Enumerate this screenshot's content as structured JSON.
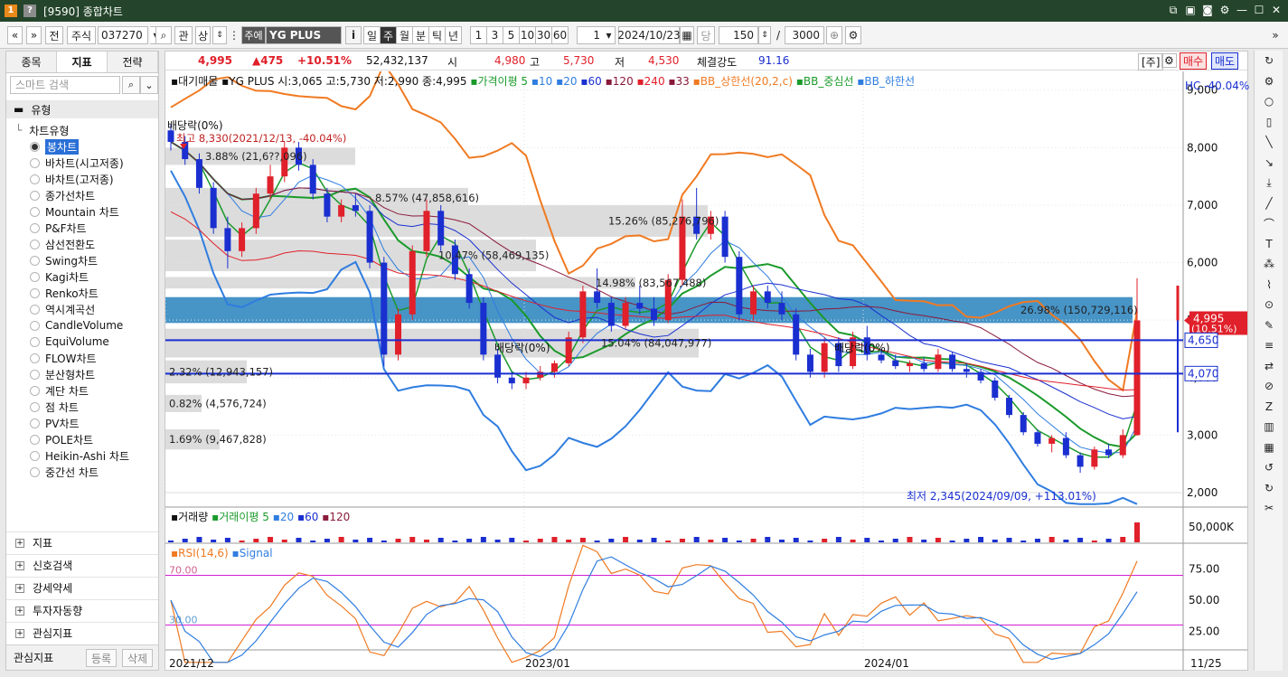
{
  "window": {
    "title": "[9590] 종합차트",
    "logo": "1",
    "help": "?"
  },
  "toolbar": {
    "nav_prev": "«",
    "nav_down": "»",
    "prev_label": "전",
    "market": "주식",
    "code": "037270",
    "search_icon": "search-icon",
    "kwan": "관",
    "sang": "상",
    "stock_badge": "주에",
    "stock_name": "YG PLUS",
    "info": "i",
    "periods": [
      "일",
      "주",
      "월",
      "분",
      "틱",
      "년"
    ],
    "active_period": "주",
    "intervals": [
      "1",
      "3",
      "5",
      "10",
      "30",
      "60"
    ],
    "spin_value": "1",
    "date": "2024/10/23",
    "dang": "당",
    "count": "150",
    "slash": "/",
    "total": "3000"
  },
  "left": {
    "tabs": [
      "종목",
      "지표",
      "전략"
    ],
    "active_tab": "지표",
    "search_placeholder": "스마트 검색",
    "group": "유형",
    "tree_title": "차트유형",
    "items": [
      "봉차트",
      "바차트(시고저종)",
      "바차트(고저종)",
      "종가선차트",
      "Mountain 차트",
      "P&F차트",
      "삼선전환도",
      "Swing차트",
      "Kagi차트",
      "Renko차트",
      "역시계곡선",
      "CandleVolume",
      "EquiVolume",
      "FLOW차트",
      "분산형차트",
      "계단 차트",
      "점 차트",
      "PV차트",
      "POLE차트",
      "Heikin-Ashi 차트",
      "중간선 차트"
    ],
    "selected_item": "봉차트",
    "folders": [
      "지표",
      "신호검색",
      "강세약세",
      "투자자동향",
      "관심지표"
    ],
    "bottom_label": "관심지표",
    "register": "등록",
    "delete": "삭제"
  },
  "quote": {
    "price": "4,995",
    "change": "▲475",
    "rate": "+10.51%",
    "volume": "52,432,137",
    "open_label": "시",
    "open": "4,980",
    "high_label": "고",
    "high": "5,730",
    "low_label": "저",
    "low": "4,530",
    "strength_label": "체결강도",
    "strength": "91.16",
    "unit": "[주]",
    "buy": "매수",
    "sell": "매도"
  },
  "legend": {
    "title": "대기매물",
    "name_label": "YG PLUS",
    "ohlc": "시:3,065 고:5,730 저:2,990 종:4,995",
    "ma_label": "가격이평 5",
    "ma_periods": [
      "10",
      "20",
      "60",
      "120",
      "240",
      "33"
    ],
    "bb_upper": "BB_상한선(20,2,c)",
    "bb_mid": "BB_중심선",
    "bb_lower": "BB_하한선",
    "hc": "HC -40.04%"
  },
  "annotations": {
    "div1": "배당락(0%)",
    "high_note": "최고 8,330(2021/12/13, -40.04%)",
    "div2": "배당락(0%)",
    "div3": "배당락(0%)",
    "low_note": "최저 2,345(2024/09/09, +113.01%)"
  },
  "profile": [
    {
      "label": "3.88% (21,6??,096)",
      "color": "#dcdcdc"
    },
    {
      "label": "8.57% (47,858,616)",
      "color": "#dcdcdc"
    },
    {
      "label": "15.26% (85,276,796)",
      "color": "#dcdcdc"
    },
    {
      "label": "10.47% (58,469,135)",
      "color": "#dcdcdc"
    },
    {
      "label": "14.98% (83,567,488)",
      "color": "#dcdcdc"
    },
    {
      "label": "26.98% (150,729,116)",
      "color": "#3d8ec4"
    },
    {
      "label": "15.04% (84,047,977)",
      "color": "#dcdcdc"
    },
    {
      "label": "2.32% (12,943,157)",
      "color": "#dcdcdc"
    },
    {
      "label": "0.82% (4,576,724)",
      "color": "#dcdcdc"
    },
    {
      "label": "1.69% (9,467,828)",
      "color": "#dcdcdc"
    }
  ],
  "price_axis": [
    "9,000",
    "8,000",
    "7,000",
    "6,000",
    "5,000",
    "4,000",
    "3,000",
    "2,000"
  ],
  "price_marks": {
    "current": "4,995",
    "current_rate": "(10.51%)",
    "line1": "4,650",
    "line2": "4,070"
  },
  "volume_panel": {
    "title": "거래량",
    "ma": "거래이평 5",
    "periods": [
      "20",
      "60",
      "120"
    ],
    "axis": "50,000K"
  },
  "rsi_panel": {
    "title": "RSI(14,6)",
    "signal": "Signal",
    "axis": [
      "75.00",
      "50.00",
      "25.00"
    ],
    "upper": "70.00",
    "lower": "30.00"
  },
  "x_axis": [
    "2021/12",
    "2023/01",
    "2024/01",
    "11/25"
  ],
  "chart_data": {
    "type": "candlestick",
    "price_ylim": [
      2000,
      9200
    ],
    "candles": [
      [
        8300,
        8400,
        7950,
        8100
      ],
      [
        8100,
        8200,
        7700,
        7800
      ],
      [
        7800,
        7900,
        7200,
        7300
      ],
      [
        7300,
        7400,
        6500,
        6600
      ],
      [
        6600,
        6800,
        5900,
        6200
      ],
      [
        6200,
        6700,
        6100,
        6600
      ],
      [
        6600,
        7300,
        6500,
        7200
      ],
      [
        7200,
        7700,
        7100,
        7500
      ],
      [
        7500,
        8100,
        7400,
        8000
      ],
      [
        8000,
        8100,
        7600,
        7700
      ],
      [
        7700,
        7800,
        7100,
        7200
      ],
      [
        7200,
        7300,
        6700,
        6800
      ],
      [
        6800,
        7100,
        6700,
        7000
      ],
      [
        7000,
        7200,
        6800,
        6900
      ],
      [
        6900,
        7000,
        5900,
        6000
      ],
      [
        6000,
        6100,
        4200,
        4400
      ],
      [
        4400,
        5200,
        4300,
        5100
      ],
      [
        5100,
        6300,
        5000,
        6200
      ],
      [
        6200,
        7100,
        6100,
        6900
      ],
      [
        6900,
        7000,
        6200,
        6300
      ],
      [
        6300,
        6400,
        5700,
        5800
      ],
      [
        5800,
        5900,
        5200,
        5300
      ],
      [
        5300,
        5400,
        4300,
        4400
      ],
      [
        4400,
        4500,
        3900,
        4000
      ],
      [
        4000,
        4100,
        3800,
        3900
      ],
      [
        3900,
        4100,
        3800,
        4000
      ],
      [
        4000,
        4200,
        3950,
        4100
      ],
      [
        4100,
        4300,
        4000,
        4250
      ],
      [
        4250,
        4800,
        4200,
        4700
      ],
      [
        4700,
        5600,
        4600,
        5500
      ],
      [
        5500,
        5900,
        5200,
        5300
      ],
      [
        5300,
        5400,
        4800,
        4900
      ],
      [
        4900,
        5400,
        4850,
        5300
      ],
      [
        5300,
        5600,
        5100,
        5200
      ],
      [
        5200,
        5400,
        4900,
        5000
      ],
      [
        5000,
        5800,
        4950,
        5700
      ],
      [
        5700,
        7100,
        5600,
        6800
      ],
      [
        6800,
        7300,
        6400,
        6500
      ],
      [
        6500,
        6900,
        6400,
        6800
      ],
      [
        6800,
        6900,
        6000,
        6100
      ],
      [
        6100,
        6200,
        5000,
        5100
      ],
      [
        5100,
        5600,
        5000,
        5500
      ],
      [
        5500,
        5600,
        5200,
        5300
      ],
      [
        5300,
        5500,
        5000,
        5100
      ],
      [
        5100,
        5200,
        4300,
        4400
      ],
      [
        4400,
        4500,
        4000,
        4100
      ],
      [
        4100,
        4700,
        4000,
        4600
      ],
      [
        4600,
        4700,
        4100,
        4200
      ],
      [
        4200,
        4800,
        4150,
        4700
      ],
      [
        4700,
        4900,
        4300,
        4400
      ],
      [
        4400,
        4500,
        4250,
        4300
      ],
      [
        4300,
        4400,
        4150,
        4200
      ],
      [
        4200,
        4300,
        4100,
        4250
      ],
      [
        4250,
        4350,
        4100,
        4150
      ],
      [
        4150,
        4500,
        4100,
        4400
      ],
      [
        4400,
        4450,
        4100,
        4150
      ],
      [
        4150,
        4250,
        4000,
        4100
      ],
      [
        4100,
        4150,
        3900,
        3950
      ],
      [
        3950,
        4000,
        3600,
        3650
      ],
      [
        3650,
        3700,
        3300,
        3350
      ],
      [
        3350,
        3400,
        3000,
        3050
      ],
      [
        3050,
        3100,
        2800,
        2850
      ],
      [
        2850,
        3000,
        2700,
        2950
      ],
      [
        2950,
        3050,
        2600,
        2650
      ],
      [
        2650,
        2700,
        2345,
        2450
      ],
      [
        2450,
        2800,
        2400,
        2750
      ],
      [
        2750,
        2850,
        2600,
        2650
      ],
      [
        2650,
        3100,
        2600,
        3000
      ],
      [
        3000,
        5730,
        2990,
        4995
      ]
    ],
    "volume_max": 60000,
    "rsi_levels": [
      70,
      30
    ]
  },
  "colors": {
    "up": "#e0202a",
    "down": "#1a2fd0",
    "bb_upper": "#f07a22",
    "bb_mid": "#1a9a2a",
    "bb_lower": "#2f7de0",
    "profile_hi": "#3d8ec4",
    "title_bg": "#24452b"
  }
}
